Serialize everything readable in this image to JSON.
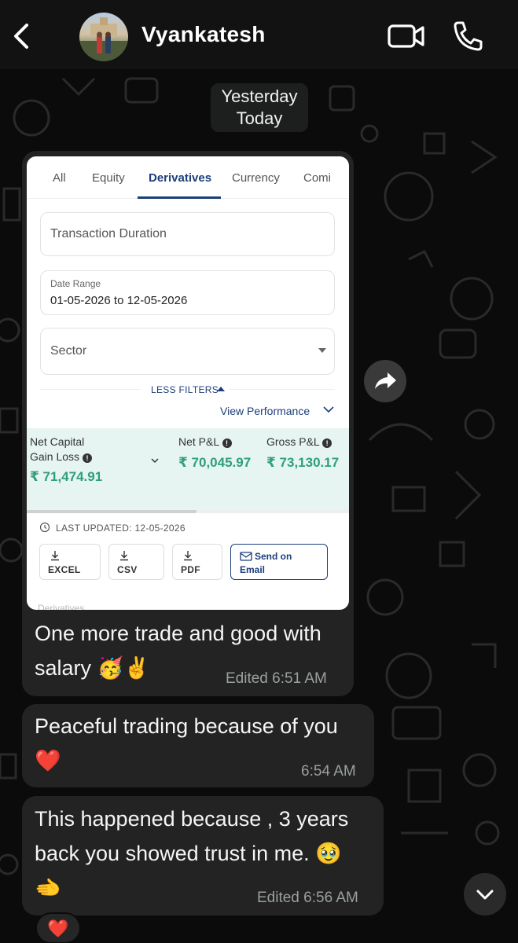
{
  "header": {
    "contact_name": "Vyankatesh",
    "back_icon": "chevron-left-icon",
    "video_icon": "video-camera-icon",
    "call_icon": "phone-icon"
  },
  "date_chip": {
    "line1": "Yesterday",
    "line2": "Today"
  },
  "shared_image": {
    "tabs": [
      "All",
      "Equity",
      "Derivatives",
      "Currency",
      "Comi"
    ],
    "active_tab": "Derivatives",
    "transaction_duration": "Transaction Duration",
    "date_range_label": "Date Range",
    "date_range_value": "01-05-2026 to 12-05-2026",
    "sector": "Sector",
    "less_filters": "LESS FILTERS",
    "view_performance": "View Performance",
    "net_capital_gain_loss_line1": "Net Capital",
    "net_capital_gain_loss_line2": "Gain Loss",
    "net_capital_gain_loss_value": "₹ 71,474.91",
    "net_pnl_label": "Net P&L",
    "net_pnl_value": "₹ 70,045.97",
    "gross_pnl_label": "Gross P&L",
    "gross_pnl_value": "₹ 73,130.17",
    "last_updated": "LAST UPDATED: 12-05-2026",
    "buttons": {
      "excel": "EXCEL",
      "csv": "CSV",
      "pdf": "PDF",
      "send_on": "Send on",
      "email": "Email"
    },
    "cut_off_text": "Derivatives"
  },
  "messages": [
    {
      "line1": "One more trade and good with",
      "line2": "salary",
      "emojis": "🥳✌️",
      "meta": "Edited 6:51 AM"
    },
    {
      "line1": "Peaceful trading because of you",
      "line2": "❤️",
      "meta": "6:54 AM"
    },
    {
      "line1": "This happened because , 3 years",
      "line2": "back you showed trust in me. 🥹",
      "line3": "🫲",
      "meta": "Edited 6:56 AM"
    }
  ],
  "reaction": "❤️",
  "colors": {
    "accent_blue": "#1c3e7a",
    "profit_green": "#2f9e7c",
    "bubble": "#222322"
  }
}
